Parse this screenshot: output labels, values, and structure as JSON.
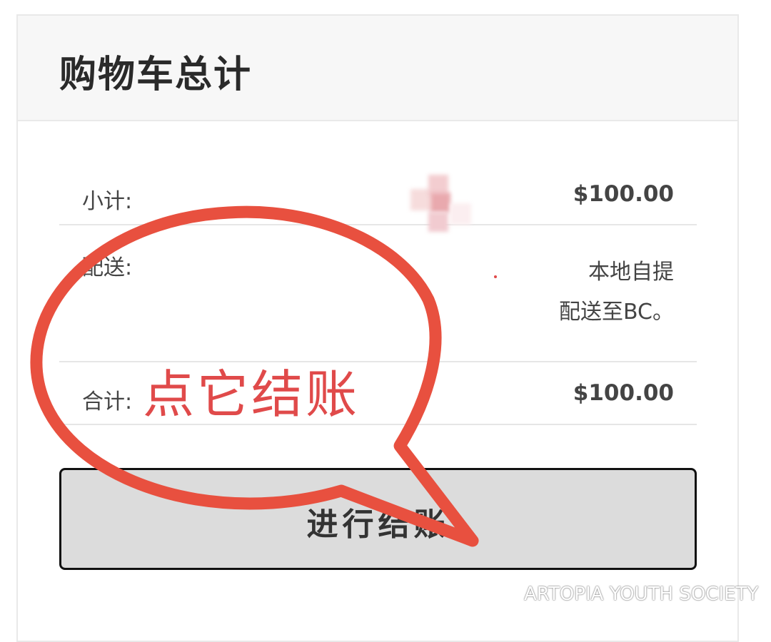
{
  "cart_totals": {
    "title": "购物车总计",
    "subtotal": {
      "label": "小计:",
      "value": "$100.00"
    },
    "shipping": {
      "label": "配送:",
      "method": "本地自提",
      "destination": "配送至BC。"
    },
    "total": {
      "label": "合计:",
      "value": "$100.00"
    },
    "checkout_button": "进行结账"
  },
  "annotation": {
    "callout_text": "点它结账",
    "color": "#e04a4a"
  },
  "watermark": {
    "text": "ARTOPIA YOUTH SOCIETY",
    "icon": "wechat-icon"
  },
  "colors": {
    "button_bg": "#dcdcdc",
    "header_bg": "#f7f7f7",
    "annotation_red": "#e04a4a"
  }
}
